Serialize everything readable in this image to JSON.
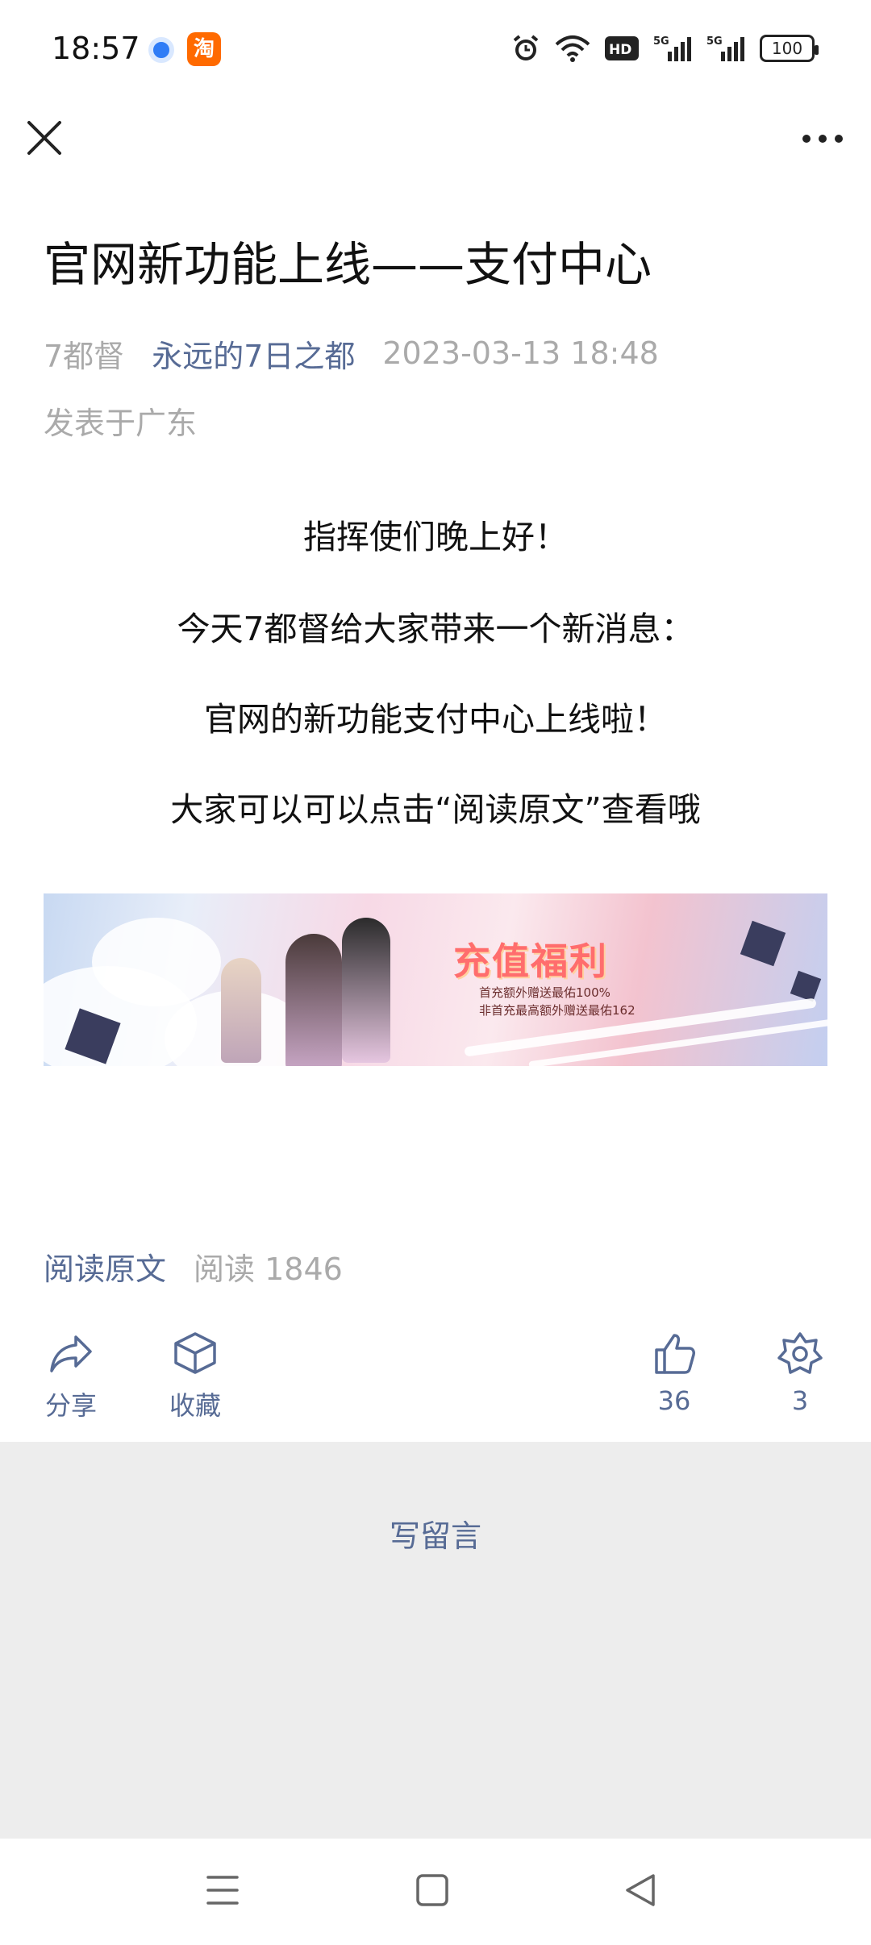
{
  "status_bar": {
    "time": "18:57",
    "app2_label": "淘",
    "battery": "100"
  },
  "article": {
    "title": "官网新功能上线——支付中心",
    "author_tag": "7都督",
    "account_name": "永远的7日之都",
    "date": "2023-03-13 18:48",
    "location": "发表于广东",
    "paragraphs": [
      "指挥使们晚上好！",
      "今天7都督给大家带来一个新消息：",
      "官网的新功能支付中心上线啦！",
      "大家可以可以点击“阅读原文”查看哦"
    ],
    "banner": {
      "title": "充值福利",
      "line1": "首充额外赠送最佑100%",
      "line2": "非首充最高额外赠送最佑162"
    },
    "read_original": "阅读原文",
    "read_count": "阅读 1846"
  },
  "actions": {
    "share_label": "分享",
    "favorite_label": "收藏",
    "like_count": "36",
    "wow_count": "3"
  },
  "comment": {
    "write_label": "写留言"
  },
  "colors": {
    "link": "#576b95",
    "muted": "#aaaaaa",
    "comment_bg": "#ededed"
  }
}
